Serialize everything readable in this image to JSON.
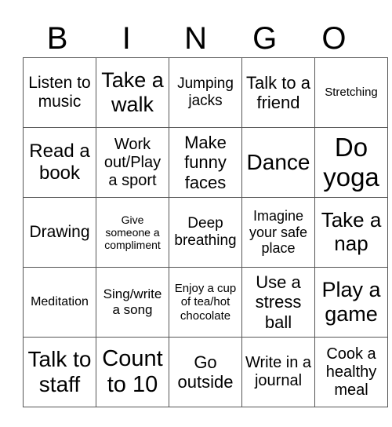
{
  "header": [
    "B",
    "I",
    "N",
    "G",
    "O"
  ],
  "rows": [
    [
      {
        "text": "Listen to music",
        "size": 21
      },
      {
        "text": "Take a walk",
        "size": 27
      },
      {
        "text": "Jumping jacks",
        "size": 19
      },
      {
        "text": "Talk to a friend",
        "size": 22
      },
      {
        "text": "Stretching",
        "size": 15
      }
    ],
    [
      {
        "text": "Read a book",
        "size": 24
      },
      {
        "text": "Work out/Play a sport",
        "size": 20
      },
      {
        "text": "Make funny faces",
        "size": 22
      },
      {
        "text": "Dance",
        "size": 28
      },
      {
        "text": "Do yoga",
        "size": 33
      }
    ],
    [
      {
        "text": "Drawing",
        "size": 21
      },
      {
        "text": "Give someone a compliment",
        "size": 14
      },
      {
        "text": "Deep breathing",
        "size": 19
      },
      {
        "text": "Imagine your safe place",
        "size": 18
      },
      {
        "text": "Take a nap",
        "size": 26
      }
    ],
    [
      {
        "text": "Meditation",
        "size": 16
      },
      {
        "text": "Sing/write a song",
        "size": 17
      },
      {
        "text": "Enjoy a cup of tea/hot chocolate",
        "size": 15
      },
      {
        "text": "Use a stress ball",
        "size": 22
      },
      {
        "text": "Play a game",
        "size": 27
      }
    ],
    [
      {
        "text": "Talk to staff",
        "size": 28
      },
      {
        "text": "Count to 10",
        "size": 29
      },
      {
        "text": "Go outside",
        "size": 22
      },
      {
        "text": "Write in a journal",
        "size": 20
      },
      {
        "text": "Cook a healthy meal",
        "size": 20
      }
    ]
  ]
}
